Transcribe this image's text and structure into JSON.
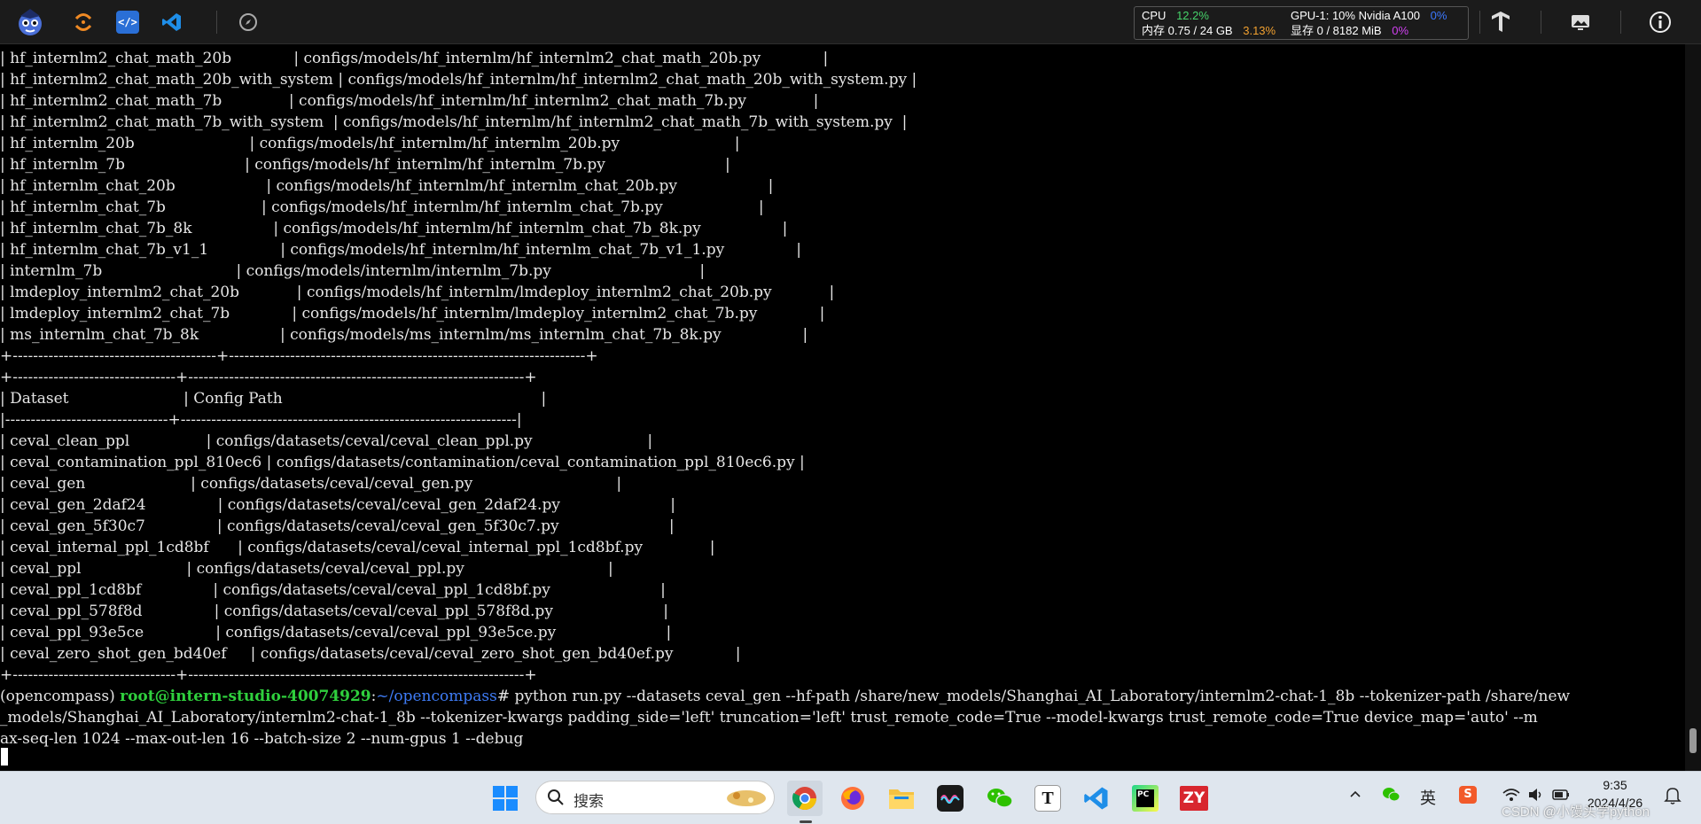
{
  "toolbar": {
    "icons": [
      "mascot-logo-icon",
      "refresh-icon",
      "code-editor-icon",
      "vscode-icon",
      "compass-icon",
      "tensorflow-icon",
      "monitor-image-icon",
      "info-icon"
    ],
    "stats": {
      "cpu_label": "CPU",
      "cpu_value": "12.2%",
      "gpu_label": "GPU-1: 10% Nvidia A100",
      "gpu_value": "0%",
      "mem_label": "内存 0.75 / 24 GB",
      "mem_value": "3.13%",
      "vram_label": "显存 0 / 8182 MiB",
      "vram_value": "0%"
    }
  },
  "terminal": {
    "lines": [
      "| hf_internlm2_chat_math_20b             | configs/models/hf_internlm/hf_internlm2_chat_math_20b.py             |",
      "| hf_internlm2_chat_math_20b_with_system | configs/models/hf_internlm/hf_internlm2_chat_math_20b_with_system.py |",
      "| hf_internlm2_chat_math_7b              | configs/models/hf_internlm/hf_internlm2_chat_math_7b.py              |",
      "| hf_internlm2_chat_math_7b_with_system  | configs/models/hf_internlm/hf_internlm2_chat_math_7b_with_system.py  |",
      "| hf_internlm_20b                        | configs/models/hf_internlm/hf_internlm_20b.py                        |",
      "| hf_internlm_7b                         | configs/models/hf_internlm/hf_internlm_7b.py                         |",
      "| hf_internlm_chat_20b                   | configs/models/hf_internlm/hf_internlm_chat_20b.py                   |",
      "| hf_internlm_chat_7b                    | configs/models/hf_internlm/hf_internlm_chat_7b.py                    |",
      "| hf_internlm_chat_7b_8k                 | configs/models/hf_internlm/hf_internlm_chat_7b_8k.py                 |",
      "| hf_internlm_chat_7b_v1_1               | configs/models/hf_internlm/hf_internlm_chat_7b_v1_1.py               |",
      "| internlm_7b                            | configs/models/internlm/internlm_7b.py                               |",
      "| lmdeploy_internlm2_chat_20b            | configs/models/hf_internlm/lmdeploy_internlm2_chat_20b.py            |",
      "| lmdeploy_internlm2_chat_7b             | configs/models/hf_internlm/lmdeploy_internlm2_chat_7b.py             |",
      "| ms_internlm_chat_7b_8k                 | configs/models/ms_internlm/ms_internlm_chat_7b_8k.py                 |",
      "+----------------------------------------+----------------------------------------------------------------------+",
      "+--------------------------------+------------------------------------------------------------------+",
      "| Dataset                        | Config Path                                                      |",
      "|--------------------------------+------------------------------------------------------------------|",
      "| ceval_clean_ppl                | configs/datasets/ceval/ceval_clean_ppl.py                        |",
      "| ceval_contamination_ppl_810ec6 | configs/datasets/contamination/ceval_contamination_ppl_810ec6.py |",
      "| ceval_gen                      | configs/datasets/ceval/ceval_gen.py                              |",
      "| ceval_gen_2daf24               | configs/datasets/ceval/ceval_gen_2daf24.py                       |",
      "| ceval_gen_5f30c7               | configs/datasets/ceval/ceval_gen_5f30c7.py                       |",
      "| ceval_internal_ppl_1cd8bf      | configs/datasets/ceval/ceval_internal_ppl_1cd8bf.py              |",
      "| ceval_ppl                      | configs/datasets/ceval/ceval_ppl.py                              |",
      "| ceval_ppl_1cd8bf               | configs/datasets/ceval/ceval_ppl_1cd8bf.py                       |",
      "| ceval_ppl_578f8d               | configs/datasets/ceval/ceval_ppl_578f8d.py                       |",
      "| ceval_ppl_93e5ce               | configs/datasets/ceval/ceval_ppl_93e5ce.py                       |",
      "| ceval_zero_shot_gen_bd40ef     | configs/datasets/ceval/ceval_zero_shot_gen_bd40ef.py             |",
      "+--------------------------------+------------------------------------------------------------------+"
    ],
    "prompt": {
      "env": "(opencompass) ",
      "user": "root@intern-studio-40074929",
      "colon": ":",
      "path": "~/opencompass",
      "symbol": "# ",
      "command": "python run.py --datasets ceval_gen --hf-path /share/new_models/Shanghai_AI_Laboratory/internlm2-chat-1_8b --tokenizer-path /share/new"
    },
    "wrap_lines": [
      "_models/Shanghai_AI_Laboratory/internlm2-chat-1_8b --tokenizer-kwargs padding_side='left' truncation='left' trust_remote_code=True --model-kwargs trust_remote_code=True device_map='auto' --m",
      "ax-seq-len 1024 --max-out-len 16 --batch-size 2 --num-gpus 1 --debug"
    ]
  },
  "taskbar": {
    "search_placeholder": "搜索",
    "apps": [
      "windows-start-icon",
      "chrome-icon",
      "firefox-icon",
      "file-explorer-icon",
      "audio-app-icon",
      "wechat-icon",
      "typora-icon",
      "vscode-taskbar-icon",
      "pycharm-icon",
      "zy-app-icon"
    ],
    "tray": {
      "input_method": "英",
      "time": "9:35",
      "date": "2024/4/26",
      "watermark": "CSDN @小馒头学python"
    }
  }
}
